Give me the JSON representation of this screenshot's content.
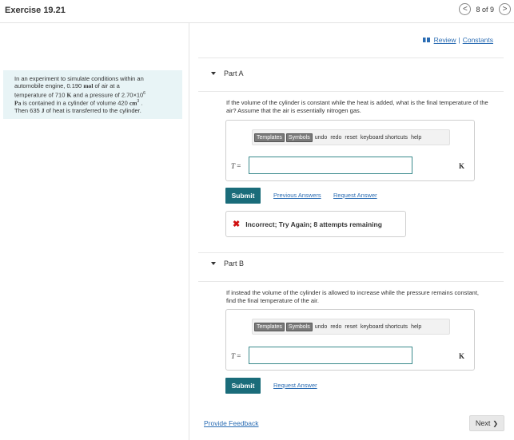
{
  "header": {
    "title": "Exercise 19.21",
    "page_indicator": "8 of 9",
    "prev_glyph": "<",
    "next_glyph": ">"
  },
  "links": {
    "review": "Review",
    "divider": "|",
    "constants": "Constants"
  },
  "problem": {
    "line1": "In an experiment to simulate conditions within an",
    "line2a": "automobile engine, 0.190 ",
    "line2b": "mol",
    "line2c": " of air at a",
    "line3a": "temperature of 710 ",
    "line3b": "K",
    "line3c": " and a pressure of 2.70×10",
    "line3sup": "6",
    "line4a": "Pa",
    "line4b": " is contained in a cylinder of volume 420 ",
    "line4c": "cm",
    "line4sup": "3",
    "line4d": " .",
    "line5a": "Then 635 ",
    "line5b": "J",
    "line5c": " of heat is transferred to the cylinder."
  },
  "partA": {
    "label": "Part A",
    "question": "If the volume of the cylinder is constant while the heat is added, what is the final temperature of the air? Assume that the air is essentially nitrogen gas.",
    "var": "T",
    "eq": " =",
    "unit": "K",
    "input_value": "",
    "submit": "Submit",
    "prev_answers": "Previous Answers",
    "request": "Request Answer",
    "feedback": "Incorrect; Try Again; 8 attempts remaining"
  },
  "partB": {
    "label": "Part B",
    "question": "If instead the volume of the cylinder is allowed to increase while the pressure remains constant, find the final temperature of the air.",
    "var": "T",
    "eq": " =",
    "unit": "K",
    "input_value": "",
    "submit": "Submit",
    "request": "Request Answer"
  },
  "toolbar": {
    "templates": "Templates",
    "symbols": "Symbols",
    "undo": "undo",
    "redo": "redo",
    "reset": "reset",
    "shortcuts": "keyboard shortcuts",
    "help": "help"
  },
  "footer": {
    "feedback": "Provide Feedback",
    "next": "Next",
    "next_glyph": "❯"
  }
}
